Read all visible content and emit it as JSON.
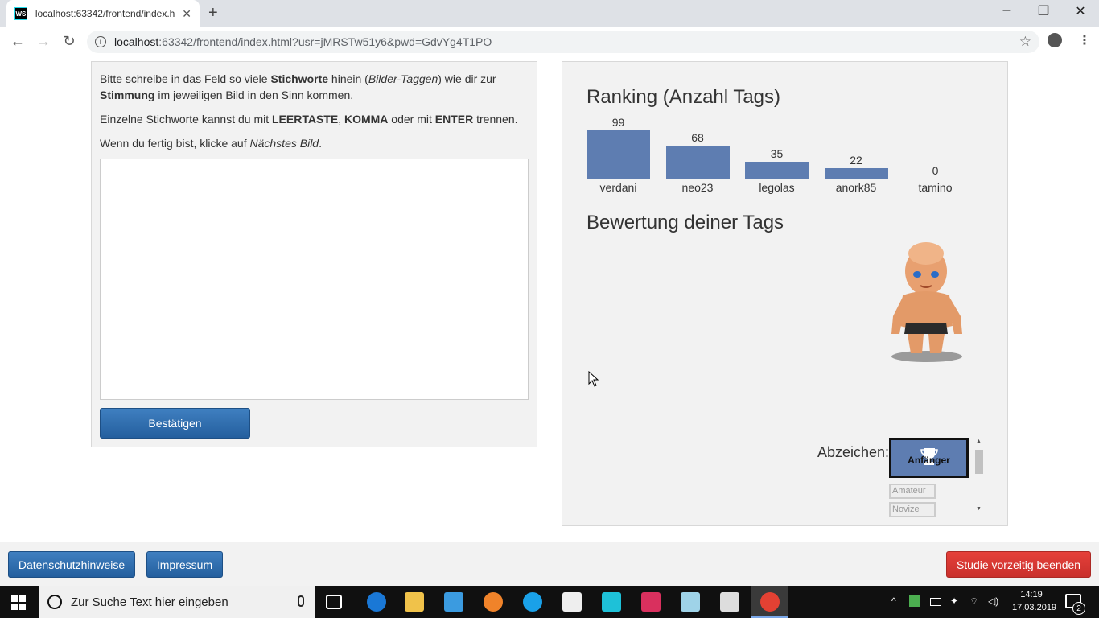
{
  "browser": {
    "tab_title": "localhost:63342/frontend/index.h",
    "favicon_text": "WS",
    "url_host": "localhost",
    "url_rest": ":63342/frontend/index.html?usr=jMRSTw51y6&pwd=GdvYg4T1PO"
  },
  "instructions": {
    "p1_a": "Bitte schreibe in das Feld so viele ",
    "p1_b": "Stichworte",
    "p1_c": " hinein (",
    "p1_d": "Bilder-Taggen",
    "p1_e": ") wie dir zur ",
    "p1_f": "Stimmung",
    "p1_g": " im jeweiligen Bild in den Sinn kommen.",
    "p2_a": "Einzelne Stichworte kannst du mit ",
    "p2_b": "LEERTASTE",
    "p2_c": ", ",
    "p2_d": "KOMMA",
    "p2_e": " oder mit ",
    "p2_f": "ENTER",
    "p2_g": " trennen.",
    "p3_a": "Wenn du fertig bist, klicke auf ",
    "p3_b": "Nächstes Bild",
    "p3_c": "."
  },
  "tag_input": {
    "value": "",
    "placeholder": ""
  },
  "confirm_label": "Bestätigen",
  "ranking": {
    "title": "Ranking (Anzahl Tags)",
    "bar_color": "#5e7db1"
  },
  "chart_data": {
    "type": "bar",
    "categories": [
      "verdani",
      "neo23",
      "legolas",
      "anork85",
      "tamino"
    ],
    "values": [
      99,
      68,
      35,
      22,
      0
    ]
  },
  "rating": {
    "title": "Bewertung deiner Tags",
    "badges_label": "Abzeichen:",
    "badges": [
      {
        "label": "Anfänger",
        "active": true
      },
      {
        "label": "Amateur",
        "active": false
      },
      {
        "label": "Novize",
        "active": false
      }
    ]
  },
  "footer": {
    "privacy_label": "Datenschutzhinweise",
    "imprint_label": "Impressum",
    "end_study_label": "Studie vorzeitig beenden"
  },
  "taskbar": {
    "search_placeholder": "Zur Suche Text hier eingeben",
    "time": "14:19",
    "date": "17.03.2019",
    "notification_count": "2"
  }
}
